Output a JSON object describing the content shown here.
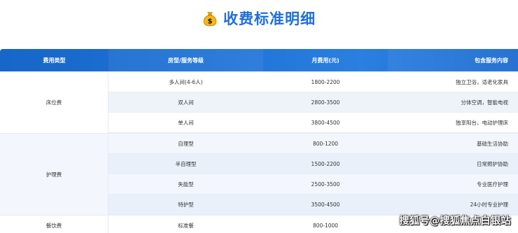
{
  "title": "收费标准明细",
  "icon": "money-bag-icon",
  "accent_color": "#1f6fd6",
  "header": {
    "type": "费用类型",
    "room": "房型/服务等级",
    "fee": "月费用(元)",
    "includes": "包含服务内容"
  },
  "groups": [
    {
      "category": "床位费",
      "rows": [
        {
          "room": "多人间(4-6人)",
          "fee": "1800-2200",
          "includes": "独立卫浴，适老化家具"
        },
        {
          "room": "双人间",
          "fee": "2800-3500",
          "includes": "分体空调，智能电视"
        },
        {
          "room": "单人间",
          "fee": "3800-4500",
          "includes": "独享阳台，电动护理床"
        }
      ]
    },
    {
      "category": "护理费",
      "rows": [
        {
          "room": "自理型",
          "fee": "800-1200",
          "includes": "基础生活协助"
        },
        {
          "room": "半自理型",
          "fee": "1500-2200",
          "includes": "日常照护协助"
        },
        {
          "room": "失能型",
          "fee": "2500-3500",
          "includes": "专业医疗护理"
        },
        {
          "room": "特护型",
          "fee": "3500-4500",
          "includes": "24小时专业护理"
        }
      ]
    },
    {
      "category": "餐饮费",
      "rows": [
        {
          "room": "标准餐",
          "fee": "800-1000",
          "includes": ""
        }
      ]
    }
  ],
  "watermark": "搜狐号@搜狐焦点白银站"
}
